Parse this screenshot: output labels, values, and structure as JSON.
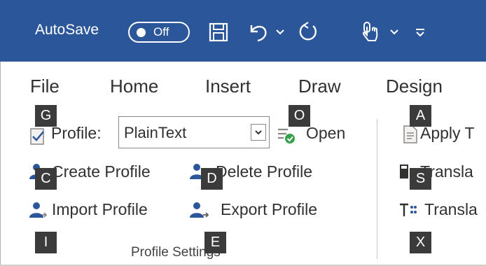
{
  "titlebar": {
    "autosave_label": "AutoSave",
    "autosave_state": "Off",
    "bg_color": "#2b579a",
    "icons": [
      "save-icon",
      "undo-icon",
      "undo-dropdown-icon",
      "redo-icon",
      "touch-mode-icon",
      "touch-mode-dropdown-icon",
      "customize-toolbar-icon"
    ]
  },
  "tabs": [
    "File",
    "Home",
    "Insert",
    "Draw",
    "Design"
  ],
  "ribbon": {
    "profile_label": "Profile:",
    "profile_value": "PlainText",
    "open_label": "Open",
    "create_profile": "Create Profile",
    "delete_profile": "Delete Profile",
    "import_profile": "Import Profile",
    "export_profile": "Export  Profile",
    "apply_label": "Apply T",
    "translate_1": "Transla",
    "translate_2": "Transla",
    "group_label": "Profile Settings"
  },
  "keytips": {
    "g": "G",
    "o": "O",
    "a": "A",
    "c": "C",
    "d": "D",
    "s": "S",
    "i": "I",
    "e": "E",
    "x": "X"
  }
}
